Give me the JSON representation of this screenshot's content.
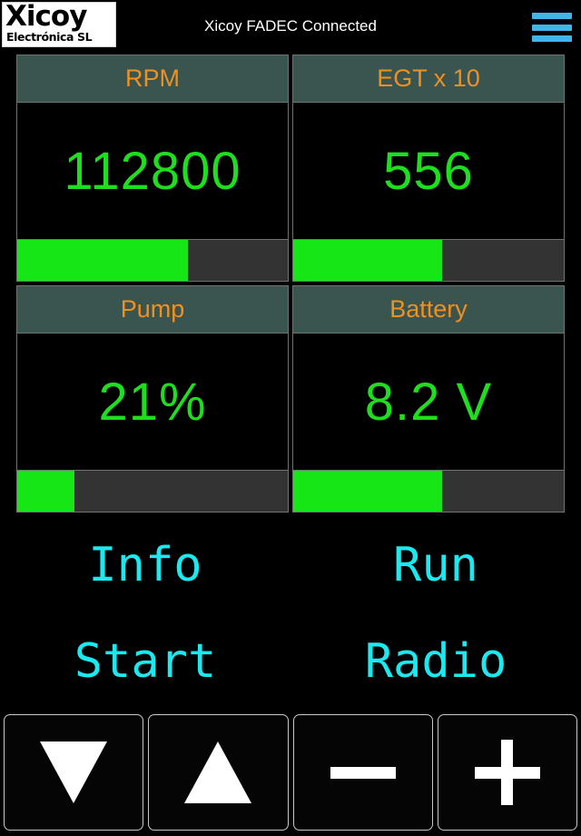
{
  "titlebar": {
    "logo_main": "Xicoy",
    "logo_sub": "Electrónica SL",
    "status_title": "Xicoy FADEC Connected",
    "menu_icon": "hamburger-menu-icon",
    "menu_color": "#41b6e6"
  },
  "colors": {
    "background": "#000000",
    "header_teal": "#3a5450",
    "header_label_orange": "#f0901e",
    "value_green": "#1fdd1f",
    "bar_fill_green": "#16e616",
    "bar_track_gray": "#333333",
    "panel_border": "#6f7471",
    "command_cyan": "#1ae9f0",
    "button_border": "#c9c9c9",
    "glyph_white": "#ffffff"
  },
  "gauges": [
    {
      "label": "RPM",
      "value": "112800",
      "bar_percent": 63
    },
    {
      "label": "EGT x 10",
      "value": "556",
      "bar_percent": 55
    },
    {
      "label": "Pump",
      "value": "21%",
      "bar_percent": 21
    },
    {
      "label": "Battery",
      "value": "8.2 V",
      "bar_percent": 55
    }
  ],
  "commands": {
    "row1": [
      {
        "label": "Info"
      },
      {
        "label": "Run"
      }
    ],
    "row2": [
      {
        "label": "Start"
      },
      {
        "label": "Radio"
      }
    ]
  },
  "icon_buttons": [
    {
      "icon": "triangle-down-icon"
    },
    {
      "icon": "triangle-up-icon"
    },
    {
      "icon": "minus-icon"
    },
    {
      "icon": "plus-icon"
    }
  ]
}
